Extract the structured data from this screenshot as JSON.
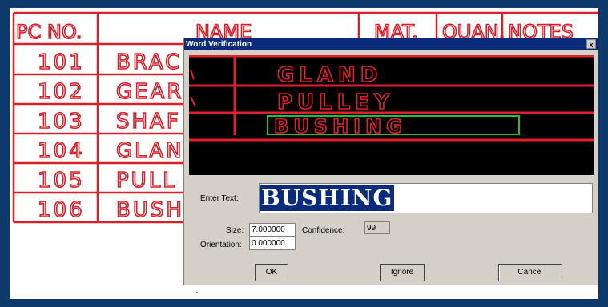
{
  "background_table": {
    "headers": [
      "PC NO.",
      "NAME",
      "MAT.",
      "QUAN.",
      "NOTES"
    ],
    "rows": [
      {
        "pc_no": "101",
        "name": "BRAC"
      },
      {
        "pc_no": "102",
        "name": "GEAR"
      },
      {
        "pc_no": "103",
        "name": "SHAF"
      },
      {
        "pc_no": "104",
        "name": "GLAN"
      },
      {
        "pc_no": "105",
        "name": "PULL"
      },
      {
        "pc_no": "106",
        "name": "BUSH"
      }
    ],
    "ink_color": "#d8202a"
  },
  "dialog": {
    "title": "Word Verification",
    "close_label": "x",
    "preview": {
      "lines": [
        "GLAND",
        "PULLEY",
        "BUSHING"
      ],
      "highlight_color": "#22c02a"
    },
    "enter_text_label": "Enter Text:",
    "enter_text_value": "BUSHING",
    "size_label": "Size:",
    "size_value": "7.000000",
    "confidence_label": "Confidence:",
    "confidence_value": "99",
    "orientation_label": "Orientation:",
    "orientation_value": "0.000000",
    "ok_label": "OK",
    "ignore_label": "Ignore",
    "cancel_label": "Cancel"
  }
}
